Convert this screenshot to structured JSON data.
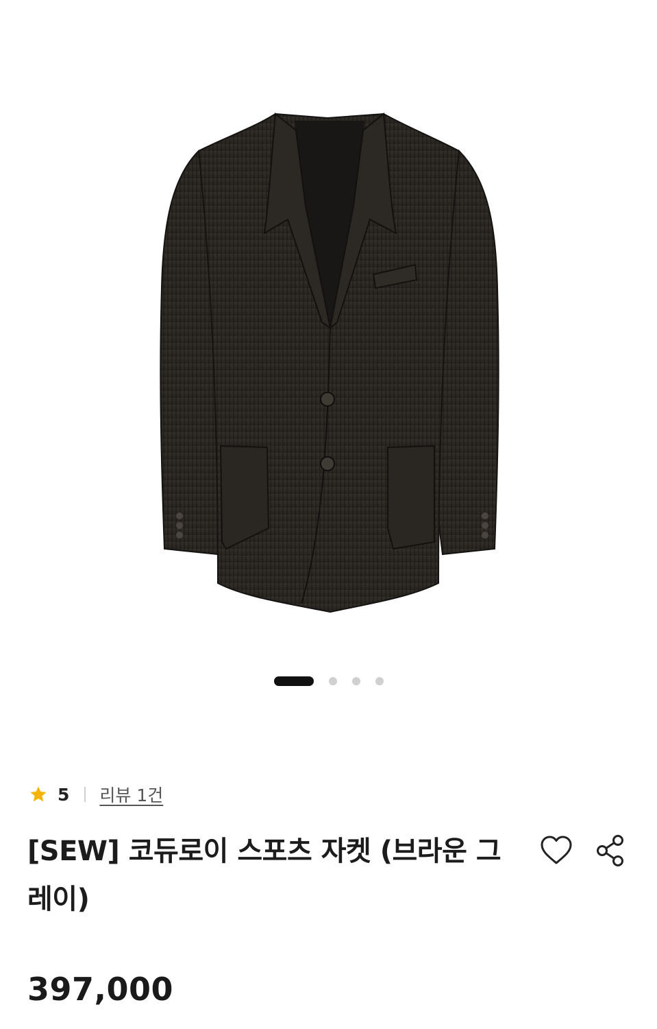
{
  "product": {
    "image": {
      "subject": "jacket-image",
      "colors": {
        "fabric": "#2a2722",
        "lining": "#1b1b1b",
        "shadow": "#121110"
      }
    },
    "carousel": {
      "total": 4,
      "active_index": 0
    },
    "rating": {
      "icon": "star-icon",
      "star_color": "#f5b301",
      "value": "5",
      "review_link": "리뷰 1건"
    },
    "title": "[SEW] 코듀로이 스포츠 자켓 (브라운 그레이)",
    "price": "397,000",
    "actions": {
      "like_icon": "heart-icon",
      "share_icon": "share-icon"
    }
  }
}
